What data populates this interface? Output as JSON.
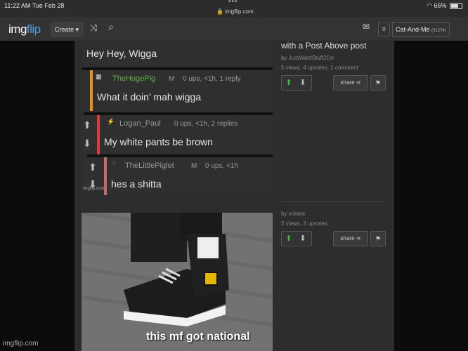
{
  "statusbar": {
    "time": "11:22 AM   Tue Feb 28",
    "url": "imgflip.com",
    "battery": "66%"
  },
  "navbar": {
    "logo_a": "img",
    "logo_b": "flip",
    "create": "Create ▾",
    "count": "0",
    "user": "Cat-And-Me",
    "user_points": "(51274)"
  },
  "comments": [
    {
      "text": "Hey Hey, Wigga"
    },
    {
      "name": "TheHugePig",
      "badge": "M",
      "meta": "0 ups, <1h, 1 reply",
      "text": "What it doin’ mah wigga",
      "bar_color": "#e8901c",
      "name_color": "#5fb04a"
    },
    {
      "name": "Logan_Paul",
      "meta": "0 ups, <1h, 2 replies",
      "text": "My white pants be brown",
      "bar_color": "#e23a3a",
      "name_color": "#999"
    },
    {
      "name": "TheLittlePiglet",
      "badge": "M",
      "meta": "0 ups, <1h",
      "text": "hes a shitta",
      "bar_color": "#c46a6a",
      "name_color": "#999"
    }
  ],
  "post1": {
    "title": "with a Post Above post",
    "by": "by JustWantStuff2Do",
    "stats": "5 views, 4 upvotes, 1 comment",
    "share": "share"
  },
  "post2": {
    "by": "by volaire",
    "stats": "2 views, 3 upvotes",
    "share": "share",
    "caption": "this mf got national"
  },
  "small_watermark": "imgflip.com",
  "footer_watermark": "imgflip.com"
}
